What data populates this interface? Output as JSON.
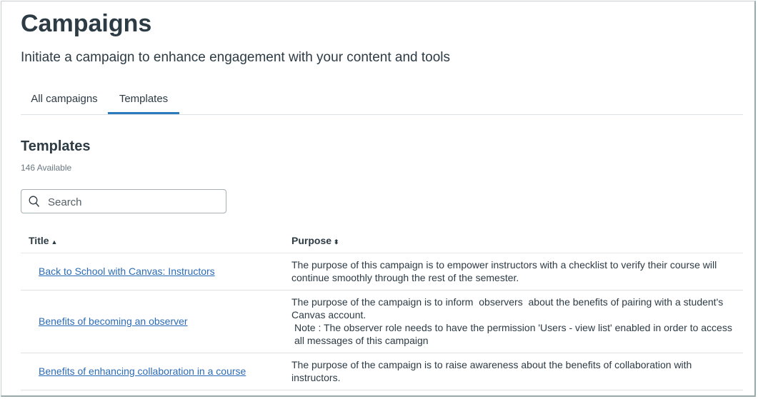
{
  "header": {
    "title": "Campaigns",
    "subtitle": "Initiate a campaign to enhance engagement with your content and tools"
  },
  "tabs": [
    {
      "label": "All campaigns"
    },
    {
      "label": "Templates"
    }
  ],
  "section": {
    "title": "Templates",
    "count": "146 Available"
  },
  "search": {
    "placeholder": "Search",
    "value": ""
  },
  "table": {
    "columns": [
      {
        "label": "Title",
        "sort": "▲"
      },
      {
        "label": "Purpose",
        "sort": "⬍"
      }
    ],
    "rows": [
      {
        "title": "Back to School with Canvas: Instructors",
        "purpose": [
          "The purpose of this campaign is to empower instructors with a checklist to verify their course will continue smoothly through the rest of the semester."
        ]
      },
      {
        "title": "Benefits of becoming an observer",
        "purpose": [
          "The purpose of the campaign is to inform  observers  about the benefits of pairing with a student's Canvas account.",
          "Note : The observer role needs to have the permission 'Users - view list' enabled in order to access all messages of this campaign"
        ]
      },
      {
        "title": "Benefits of enhancing collaboration in a course",
        "purpose": [
          "The purpose of the campaign is to raise awareness about the benefits of collaboration with instructors."
        ]
      }
    ]
  },
  "colors": {
    "accent": "#2b7abc",
    "link": "#2b6bb5",
    "text": "#2d3b45"
  }
}
